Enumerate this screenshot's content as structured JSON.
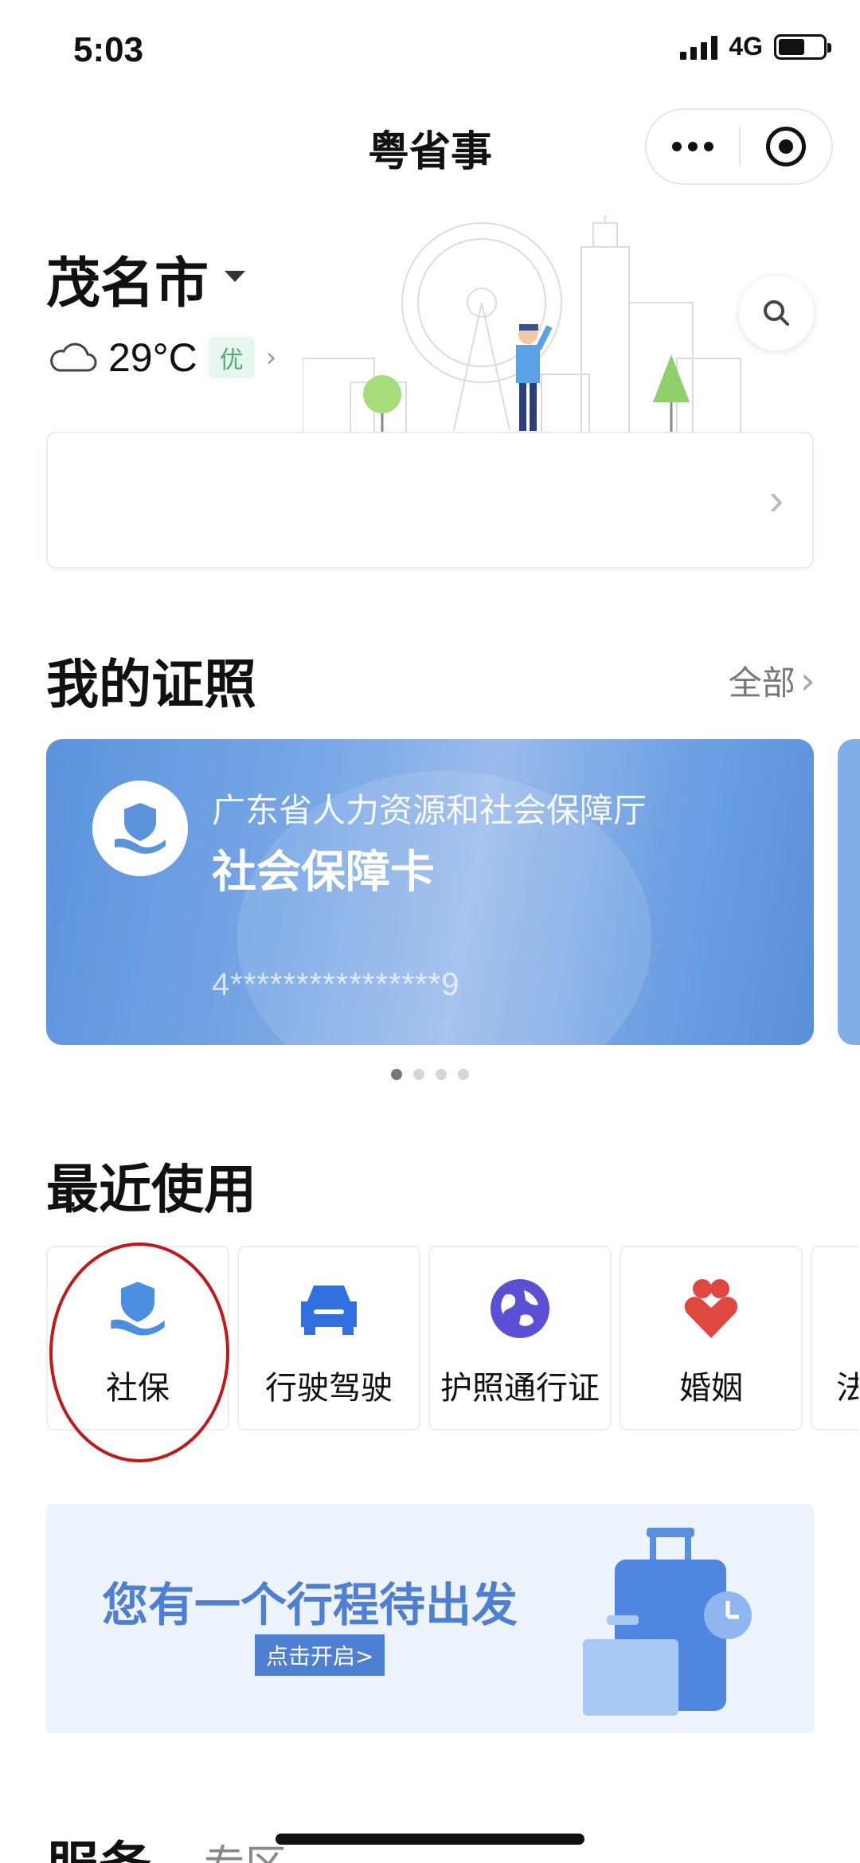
{
  "status_bar": {
    "time": "5:03",
    "network": "4G",
    "battery_level": 0.6
  },
  "nav": {
    "title": "粤省事"
  },
  "location": {
    "city": "茂名市",
    "temperature": "29°C",
    "air_quality": "优"
  },
  "licenses": {
    "title": "我的证照",
    "all_label": "全部",
    "card": {
      "issuer": "广东省人力资源和社会保障厅",
      "name": "社会保障卡",
      "number": "4****************9"
    },
    "page_count": 4,
    "active_page": 1
  },
  "recent": {
    "title": "最近使用",
    "items": [
      {
        "label": "社保",
        "icon": "social-security-icon"
      },
      {
        "label": "行驶驾驶",
        "icon": "car-icon"
      },
      {
        "label": "护照通行证",
        "icon": "globe-icon"
      },
      {
        "label": "婚姻",
        "icon": "hearts-icon"
      },
      {
        "label": "法",
        "icon": "law-icon"
      }
    ]
  },
  "trip_banner": {
    "text": "您有一个行程待出发",
    "button": "点击开启>"
  },
  "bottom": {
    "services_title": "服务",
    "zone_tab": "专区"
  },
  "colors": {
    "accent": "#4d7fd2",
    "card_blue": "#5b93dc",
    "annotation": "#c21818"
  }
}
